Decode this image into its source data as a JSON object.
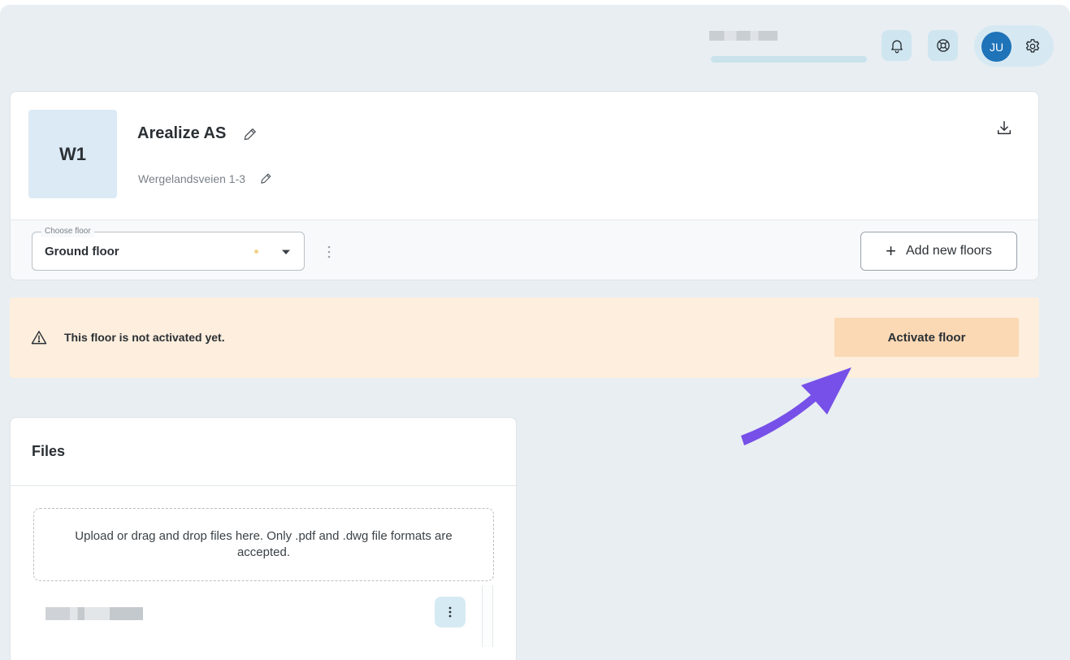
{
  "topbar": {
    "notifications_icon": "bell-icon",
    "help_icon": "lifebuoy-icon",
    "avatar_initials": "JU",
    "settings_icon": "gear-icon"
  },
  "building": {
    "code": "W1",
    "name": "Arealize AS",
    "address": "Wergelandsveien 1-3",
    "floor_select": {
      "label": "Choose floor",
      "value": "Ground floor"
    },
    "add_floors_label": "Add new floors"
  },
  "alert": {
    "message": "This floor is not activated yet.",
    "action_label": "Activate floor",
    "background": "#fdeedd",
    "button_color": "#fbd9b5"
  },
  "files": {
    "title": "Files",
    "dropzone_text": "Upload or drag and drop files here. Only .pdf and .dwg file formats are accepted."
  },
  "colors": {
    "app_background": "#e9eef2",
    "accent": "#1f73b8",
    "annotation_arrow": "#7650e8"
  }
}
